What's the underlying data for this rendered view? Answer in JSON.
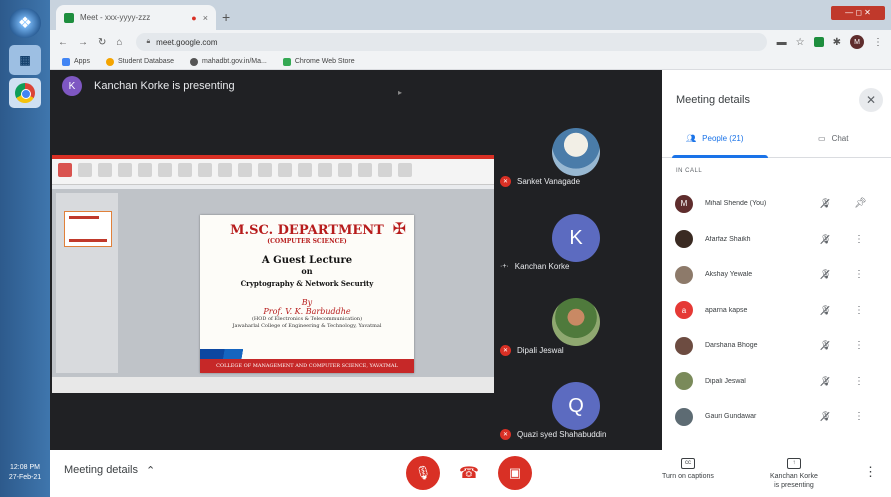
{
  "browser": {
    "tab_title": "Meet - xxx-yyyy-zzz",
    "tab_recording": "●",
    "tab_close": "×",
    "new_tab": "+",
    "window_controls": "— ◻ ✕",
    "url": "meet.google.com",
    "bookmarks": [
      {
        "label": "Apps",
        "color": "#4285f4"
      },
      {
        "label": "Student Database",
        "color": "#f4a400"
      },
      {
        "label": "mahadbt.gov.in/Ma...",
        "color": "#555555"
      },
      {
        "label": "Chrome Web Store",
        "color": "#34a853"
      }
    ],
    "profile_initial": "M"
  },
  "taskbar": {
    "clock_time": "12:08 PM",
    "clock_date": "27-Feb-21"
  },
  "stage": {
    "presenter_initial": "K",
    "presenter_text": "Kanchan Korke is presenting"
  },
  "slide": {
    "title": "M.SC. DEPARTMENT",
    "subtitle": "(COMPUTER SCIENCE)",
    "lecture": "A Guest Lecture",
    "on": "on",
    "topic": "Cryptography & Network Security",
    "by": "By",
    "professor": "Prof. V. K. Barbuddhe",
    "dept_line1": "(HOD of Electronics & Telecommunication)",
    "dept_line2": "Jawaharlal College of Engineering & Technology, Yavatmal",
    "footer": "COLLEGE OF MANAGEMENT AND COMPUTER SCIENCE, YAVATMAL"
  },
  "tiles": [
    {
      "name": "Sanket Vanagade",
      "type": "photo1",
      "initial": ""
    },
    {
      "name": "Kanchan Korke",
      "type": "letter",
      "initial": "K",
      "color": "#5c6bc0"
    },
    {
      "name": "Dipali Jeswal",
      "type": "photo2",
      "initial": ""
    },
    {
      "name": "Quazi syed Shahabuddin",
      "type": "letter",
      "initial": "Q",
      "color": "#5c6bc0"
    }
  ],
  "panel": {
    "title": "Meeting details",
    "close": "✕",
    "tab_people": "People (21)",
    "tab_chat": "Chat",
    "in_call": "IN CALL",
    "participants": [
      {
        "name": "Mihal Shende (You)",
        "initial": "M",
        "color": "#5f2d2d",
        "icon": "pin"
      },
      {
        "name": "Afarfaz Shaikh",
        "initial": "",
        "color": "#3a2a22",
        "icon": "more"
      },
      {
        "name": "Akshay Yewale",
        "initial": "",
        "color": "#8d7a6a",
        "icon": "more"
      },
      {
        "name": "aparna kapse",
        "initial": "a",
        "color": "#e53935",
        "icon": "more"
      },
      {
        "name": "Darshana Bhoge",
        "initial": "",
        "color": "#6d4c41",
        "icon": "more"
      },
      {
        "name": "Dipali Jeswal",
        "initial": "",
        "color": "#7a8a5a",
        "icon": "more"
      },
      {
        "name": "Gauri Gundawar",
        "initial": "",
        "color": "#5d6b73",
        "icon": "more"
      }
    ]
  },
  "bottom": {
    "meeting_details": "Meeting details",
    "captions": "Turn on captions",
    "presenting_line1": "Kanchan Korke",
    "presenting_line2": "is presenting"
  }
}
